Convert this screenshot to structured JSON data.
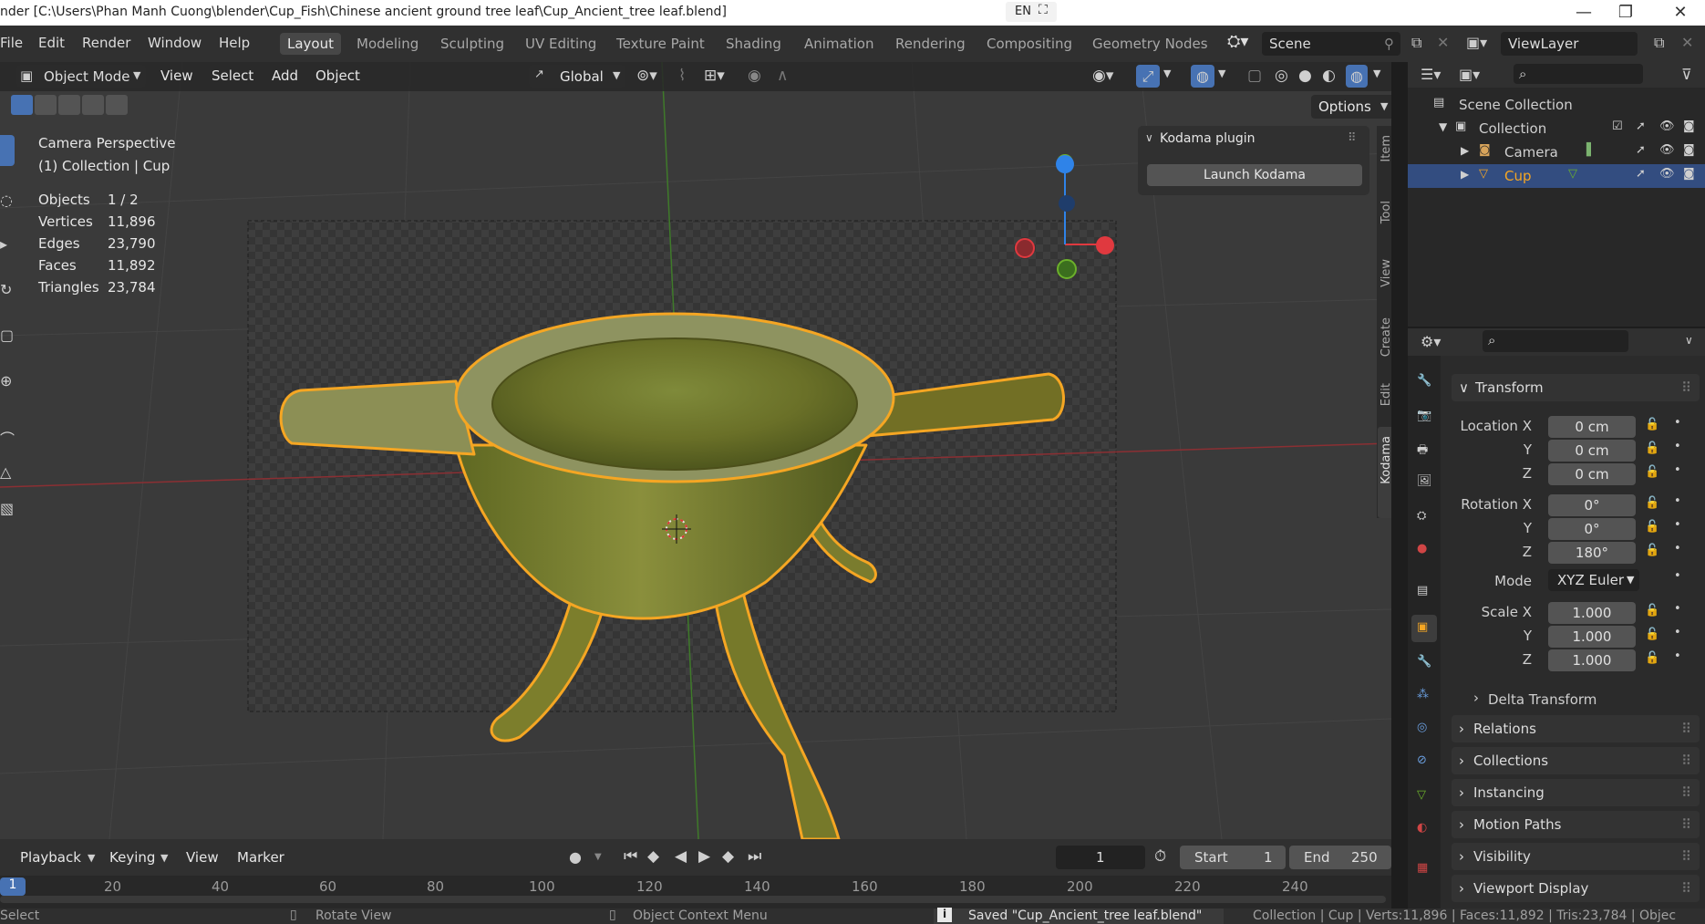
{
  "title_bar": {
    "title": "nder [C:\\Users\\Phan Manh Cuong\\blender\\Cup_Fish\\Chinese ancient ground tree leaf\\Cup_Ancient_tree leaf.blend]",
    "lang": "EN",
    "minimize": "—",
    "maximize": "❐",
    "close": "✕"
  },
  "menu": [
    "File",
    "Edit",
    "Render",
    "Window",
    "Help"
  ],
  "workspaces": [
    "Layout",
    "Modeling",
    "Sculpting",
    "UV Editing",
    "Texture Paint",
    "Shading",
    "Animation",
    "Rendering",
    "Compositing",
    "Geometry Nodes"
  ],
  "active_workspace": "Layout",
  "scene_name": "Scene",
  "view_layer": "ViewLayer",
  "viewport_header": {
    "mode": "Object Mode",
    "menus": [
      "View",
      "Select",
      "Add",
      "Object"
    ],
    "transform_orientation": "Global",
    "options": "Options"
  },
  "viewport_info": {
    "perspective": "Camera Perspective",
    "collection_line": "(1) Collection | Cup",
    "stats": [
      {
        "label": "Objects",
        "value": "1 / 2"
      },
      {
        "label": "Vertices",
        "value": "11,896"
      },
      {
        "label": "Edges",
        "value": "23,790"
      },
      {
        "label": "Faces",
        "value": "11,892"
      },
      {
        "label": "Triangles",
        "value": "23,784"
      }
    ]
  },
  "plugin_panel": {
    "title": "Kodama plugin",
    "button": "Launch Kodama"
  },
  "side_tabs": [
    "Item",
    "Tool",
    "View",
    "Create",
    "Edit",
    "Kodama"
  ],
  "gizmo": {
    "x": "X",
    "y": "Y",
    "z": "Z",
    "x_color": "#e0393f",
    "y_color": "#6cb02b",
    "z_color": "#2f83e8"
  },
  "outliner": {
    "items": [
      {
        "label": "Scene Collection"
      },
      {
        "label": "Collection"
      },
      {
        "label": "Camera"
      },
      {
        "label": "Cup"
      }
    ]
  },
  "properties": {
    "transform_title": "Transform",
    "location": {
      "x_label": "Location X",
      "x": "0 cm",
      "y_label": "Y",
      "y": "0 cm",
      "z_label": "Z",
      "z": "0 cm"
    },
    "rotation": {
      "x_label": "Rotation X",
      "x": "0°",
      "y_label": "Y",
      "y": "0°",
      "z_label": "Z",
      "z": "180°"
    },
    "mode_label": "Mode",
    "mode_value": "XYZ Euler",
    "scale": {
      "x_label": "Scale X",
      "x": "1.000",
      "y_label": "Y",
      "y": "1.000",
      "z_label": "Z",
      "z": "1.000"
    },
    "delta_transform": "Delta Transform",
    "panels": [
      "Relations",
      "Collections",
      "Instancing",
      "Motion Paths",
      "Visibility",
      "Viewport Display"
    ]
  },
  "timeline": {
    "menus": [
      "Playback",
      "Keying",
      "View",
      "Marker"
    ],
    "current_frame": "1",
    "start_label": "Start",
    "start": "1",
    "end_label": "End",
    "end": "250",
    "ticks": [
      "1",
      "20",
      "40",
      "60",
      "80",
      "100",
      "120",
      "140",
      "160",
      "180",
      "200",
      "220",
      "240"
    ]
  },
  "status_bar": {
    "select": "Select",
    "rotate": "Rotate View",
    "context": "Object Context Menu",
    "saved": "Saved \"Cup_Ancient_tree leaf.blend\"",
    "stats": "Collection | Cup | Verts:11,896 | Faces:11,892 | Tris:23,784 | Objec"
  },
  "colors": {
    "accent": "#4772b3",
    "selection_outline": "#f5a623",
    "active_tab": "#474747"
  }
}
